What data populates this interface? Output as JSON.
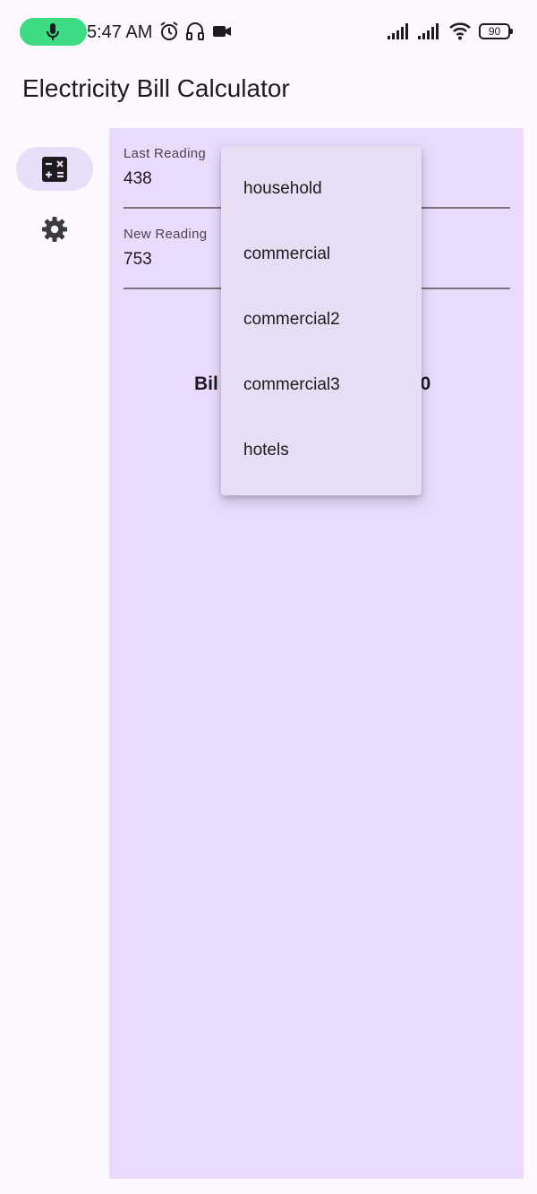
{
  "status_bar": {
    "time": "5:47 AM",
    "battery": "90",
    "icons": [
      "microphone-icon",
      "alarm-icon",
      "headset-icon",
      "video-call-icon",
      "signal-icon",
      "signal-icon",
      "wifi-icon",
      "battery-icon"
    ]
  },
  "app_bar": {
    "title": "Electricity Bill Calculator"
  },
  "nav_rail": {
    "items": [
      {
        "icon": "calculator-icon",
        "active": true
      },
      {
        "icon": "gear-icon",
        "active": false
      }
    ]
  },
  "form": {
    "last_reading": {
      "label": "Last Reading",
      "value": "438"
    },
    "new_reading": {
      "label": "New Reading",
      "value": "753"
    },
    "bill_start": "Bil",
    "bill_end": "50"
  },
  "dropdown": {
    "options": [
      "household",
      "commercial",
      "commercial2",
      "commercial3",
      "hotels"
    ]
  },
  "colors": {
    "accent": "#eadbfd",
    "nav_active": "#e8def8",
    "mic_indicator": "#3ddc84"
  }
}
